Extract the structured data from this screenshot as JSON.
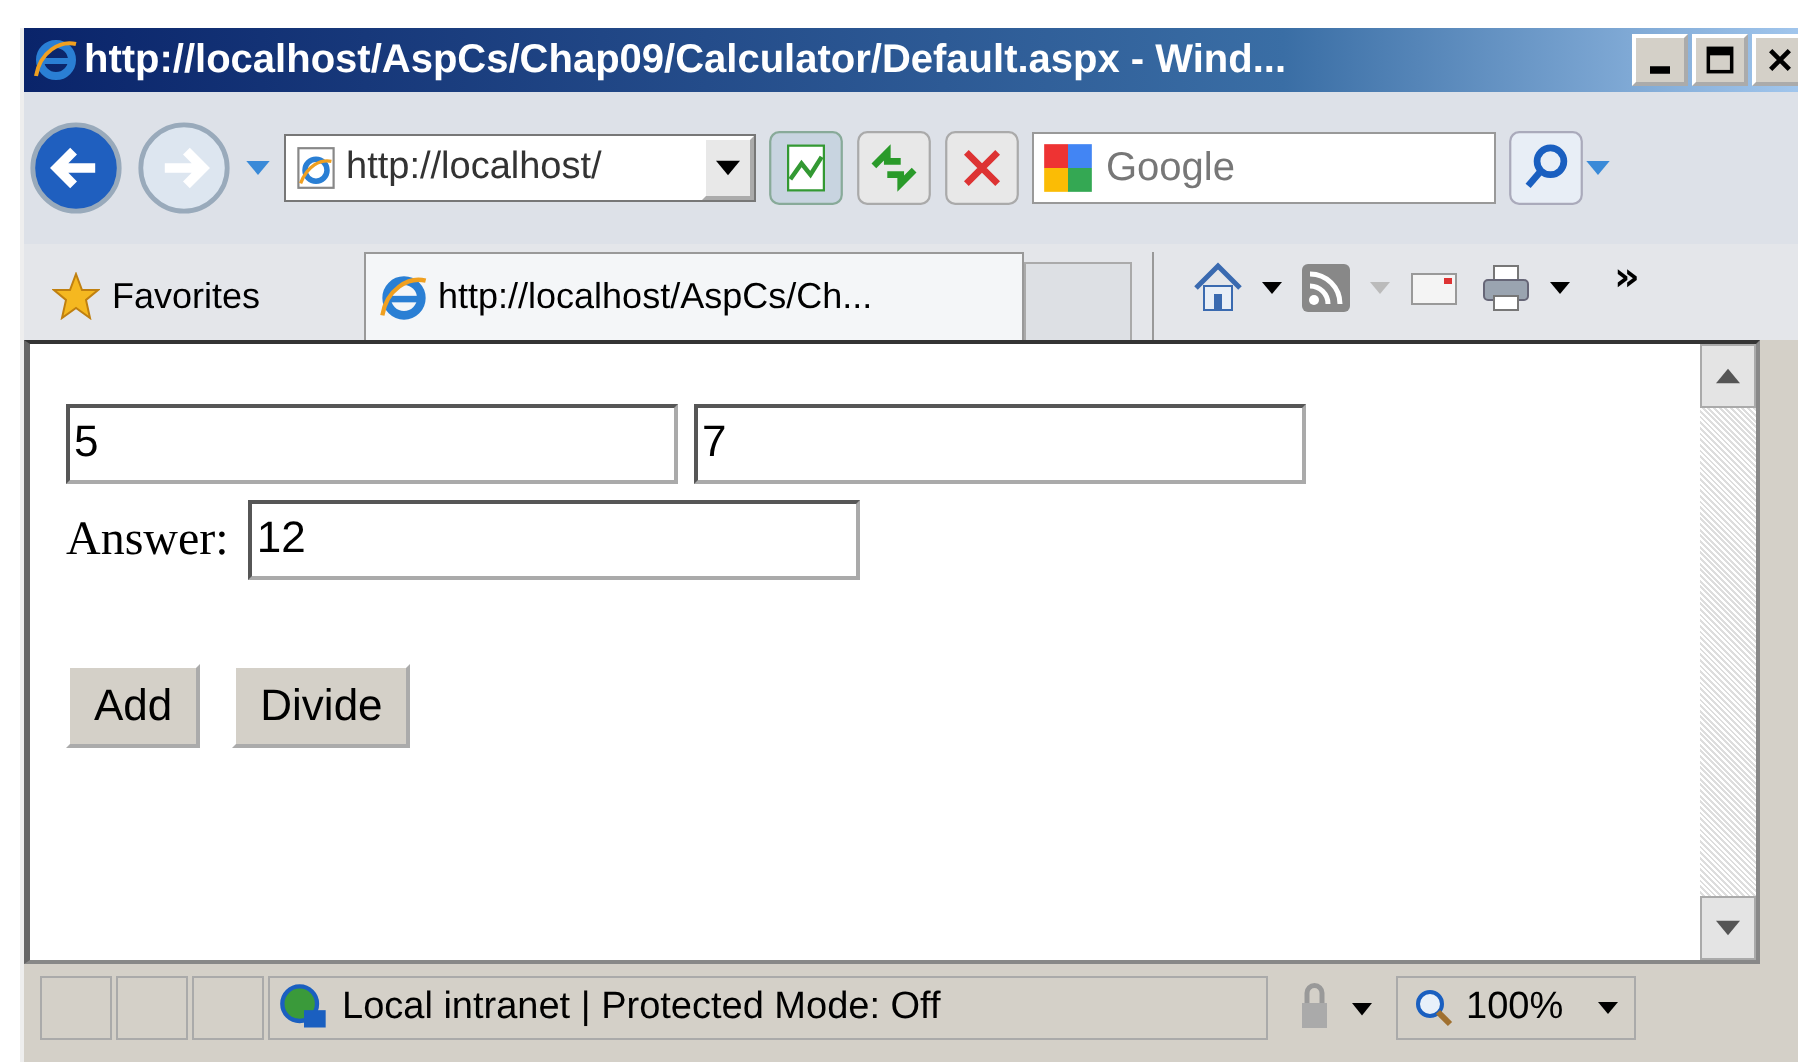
{
  "window": {
    "title": "http://localhost/AspCs/Chap09/Calculator/Default.aspx - Wind..."
  },
  "address_bar": {
    "value": "http://localhost/"
  },
  "search": {
    "placeholder": "Google"
  },
  "favorites": {
    "label": "Favorites"
  },
  "tabs": [
    {
      "label": "http://localhost/AspCs/Ch...",
      "selected": true
    }
  ],
  "toolbar_overflow": "»",
  "page": {
    "inputs": [
      {
        "value": "5"
      },
      {
        "value": "7"
      }
    ],
    "answer": {
      "label": "Answer:",
      "value": "12"
    },
    "buttons": [
      "Add",
      "Divide"
    ]
  },
  "status_bar": {
    "zone": "Local intranet | Protected Mode: Off",
    "zoom": "100%"
  }
}
